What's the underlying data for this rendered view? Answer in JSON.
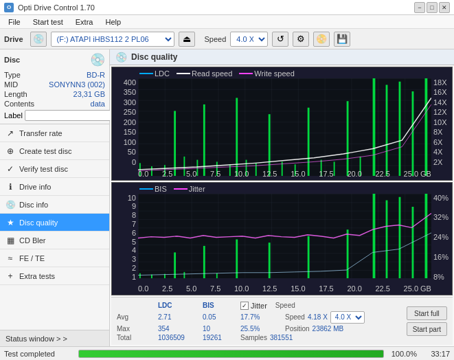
{
  "titleBar": {
    "appName": "Opti Drive Control 1.70",
    "minBtn": "−",
    "maxBtn": "□",
    "closeBtn": "✕"
  },
  "menuBar": {
    "items": [
      "File",
      "Start test",
      "Extra",
      "Help"
    ]
  },
  "driveBar": {
    "label": "Drive",
    "driveValue": "(F:)  ATAPI iHBS112  2 PL06",
    "speedLabel": "Speed",
    "speedValue": "4.0 X"
  },
  "discPanel": {
    "title": "Disc",
    "type": "BD-R",
    "mid": "SONYNN3 (002)",
    "length": "23,31 GB",
    "contents": "data",
    "labelText": "",
    "labelPlaceholder": ""
  },
  "navItems": [
    {
      "id": "transfer-rate",
      "label": "Transfer rate",
      "icon": "↗"
    },
    {
      "id": "create-test-disc",
      "label": "Create test disc",
      "icon": "⊕"
    },
    {
      "id": "verify-test-disc",
      "label": "Verify test disc",
      "icon": "✓"
    },
    {
      "id": "drive-info",
      "label": "Drive info",
      "icon": "ℹ"
    },
    {
      "id": "disc-info",
      "label": "Disc info",
      "icon": "💿"
    },
    {
      "id": "disc-quality",
      "label": "Disc quality",
      "icon": "★",
      "active": true
    },
    {
      "id": "cd-bler",
      "label": "CD Bler",
      "icon": "▦"
    },
    {
      "id": "fe-te",
      "label": "FE / TE",
      "icon": "≈"
    },
    {
      "id": "extra-tests",
      "label": "Extra tests",
      "icon": "+"
    }
  ],
  "statusWindow": {
    "label": "Status window > >"
  },
  "discQuality": {
    "title": "Disc quality",
    "legend1": {
      "ldc": "LDC",
      "readSpeed": "Read speed",
      "writeSpeed": "Write speed"
    },
    "chart1": {
      "yAxisLeft": [
        "400",
        "350",
        "300",
        "250",
        "200",
        "150",
        "100",
        "50",
        "0"
      ],
      "yAxisRight": [
        "18X",
        "16X",
        "14X",
        "12X",
        "10X",
        "8X",
        "6X",
        "4X",
        "2X"
      ],
      "xAxis": [
        "0.0",
        "2.5",
        "5.0",
        "7.5",
        "10.0",
        "12.5",
        "15.0",
        "17.5",
        "20.0",
        "22.5",
        "25.0 GB"
      ]
    },
    "legend2": {
      "bis": "BIS",
      "jitter": "Jitter"
    },
    "chart2": {
      "yAxisLeft": [
        "10",
        "9",
        "8",
        "7",
        "6",
        "5",
        "4",
        "3",
        "2",
        "1"
      ],
      "yAxisRight": [
        "40%",
        "32%",
        "24%",
        "16%",
        "8%"
      ],
      "xAxis": [
        "0.0",
        "2.5",
        "5.0",
        "7.5",
        "10.0",
        "12.5",
        "15.0",
        "17.5",
        "20.0",
        "22.5",
        "25.0 GB"
      ]
    }
  },
  "stats": {
    "headers": [
      "LDC",
      "BIS",
      "Jitter",
      "Speed",
      ""
    ],
    "avg": {
      "ldc": "2.71",
      "bis": "0.05",
      "jitter": "17.7%",
      "speed": "4.18 X",
      "speedSelect": "4.0 X"
    },
    "max": {
      "ldc": "354",
      "bis": "10",
      "jitter": "25.5%",
      "position": "23862 MB"
    },
    "total": {
      "ldc": "1036509",
      "bis": "19261",
      "samples": "381551"
    },
    "jitterChecked": true,
    "startFull": "Start full",
    "startPart": "Start part"
  },
  "statusBar": {
    "text": "Test completed",
    "progress": 100,
    "percent": "100.0%",
    "time": "33:17"
  }
}
